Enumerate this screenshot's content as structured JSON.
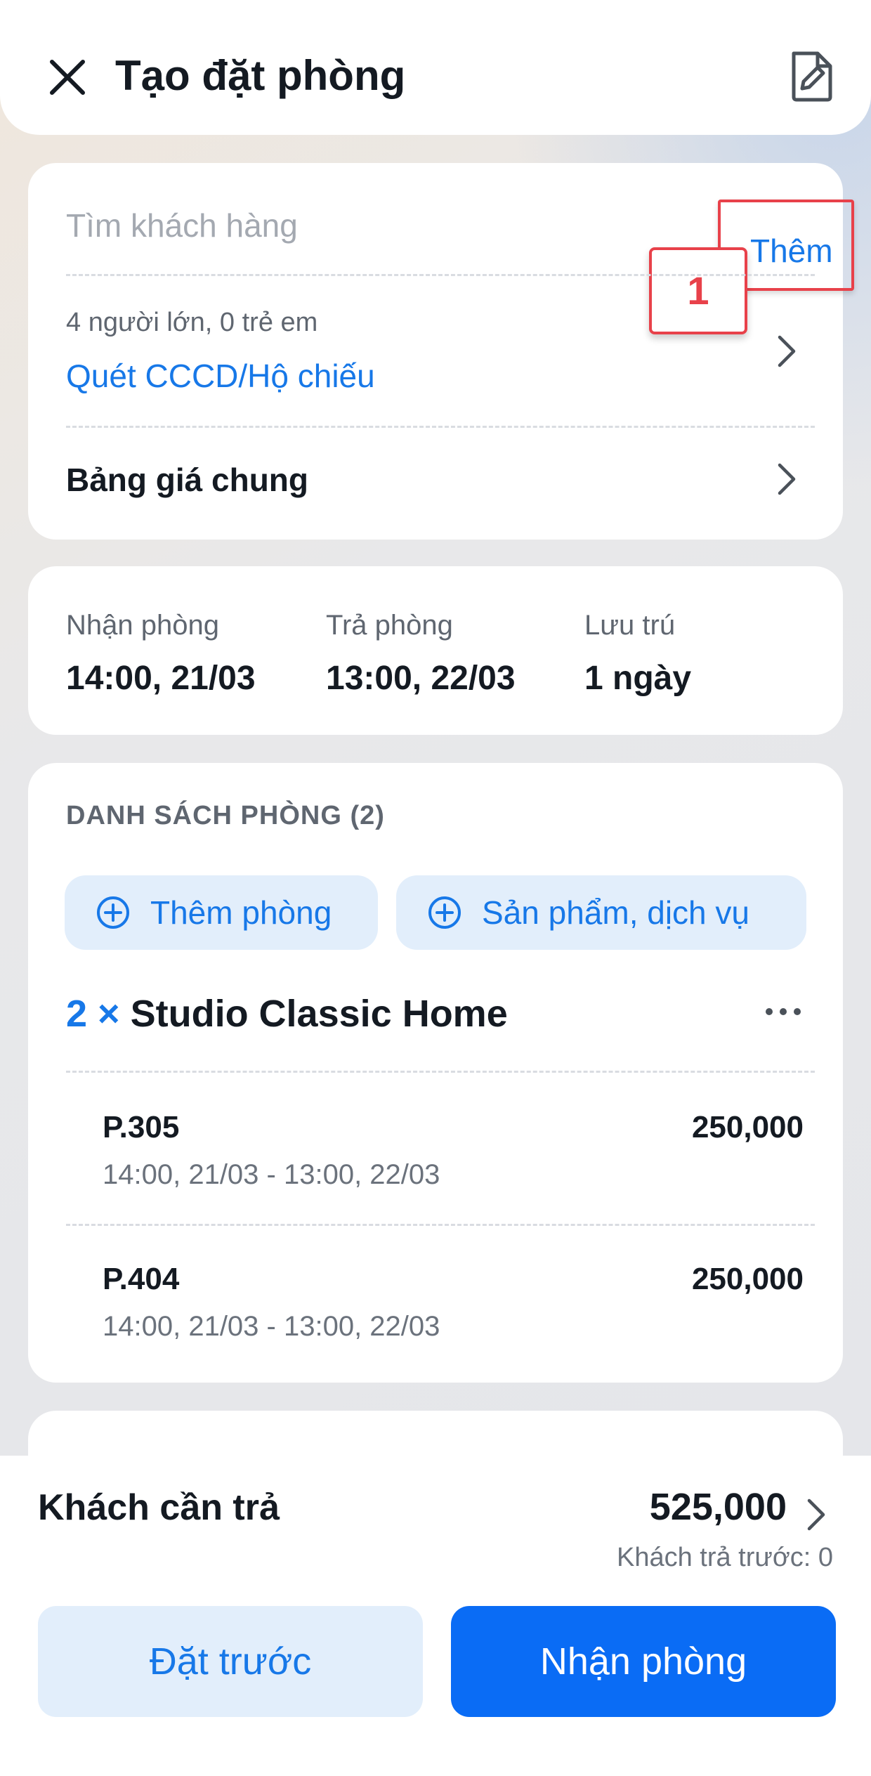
{
  "header": {
    "title": "Tạo đặt phòng"
  },
  "customer": {
    "search_placeholder": "Tìm khách hàng",
    "add_label": "Thêm",
    "step_badge": "1",
    "guests": "4 người lớn, 0 trẻ em",
    "scan_label": "Quét CCCD/Hộ chiếu",
    "pricelist": "Bảng giá chung"
  },
  "stay": {
    "checkin_label": "Nhận phòng",
    "checkin_value": "14:00, 21/03",
    "checkout_label": "Trả phòng",
    "checkout_value": "13:00, 22/03",
    "duration_label": "Lưu trú",
    "duration_value": "1 ngày"
  },
  "rooms": {
    "section_title": "DANH SÁCH PHÒNG (2)",
    "add_room_label": "Thêm phòng",
    "services_label": "Sản phẩm, dịch vụ",
    "type_qty": "2 ×",
    "type_name": "Studio Classic Home",
    "items": [
      {
        "name": "P.305",
        "price": "250,000",
        "time": "14:00, 21/03 - 13:00, 22/03"
      },
      {
        "name": "P.404",
        "price": "250,000",
        "time": "14:00, 21/03 - 13:00, 22/03"
      }
    ]
  },
  "footer": {
    "total_label": "Khách cần trả",
    "total_value": "525,000",
    "prepaid": "Khách trả trước: 0",
    "reserve_label": "Đặt trước",
    "checkin_label": "Nhận phòng"
  },
  "colors": {
    "accent": "#1778e8",
    "primary_button": "#0a6cf5",
    "highlight": "#e8414a"
  }
}
